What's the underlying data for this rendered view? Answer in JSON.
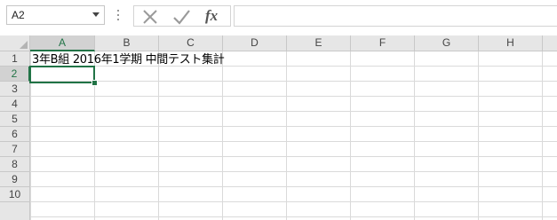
{
  "formula_bar": {
    "name_box_value": "A2",
    "fx_label": "fx",
    "formula_value": ""
  },
  "columns": [
    "A",
    "B",
    "C",
    "D",
    "E",
    "F",
    "G",
    "H"
  ],
  "rows": [
    "1",
    "2",
    "3",
    "4",
    "5",
    "6",
    "7",
    "8",
    "9",
    "10"
  ],
  "selected_cell": {
    "column": "A",
    "row": "2"
  },
  "cells": {
    "A1": "3年B組 2016年1学期 中間テスト集計"
  },
  "colors": {
    "selection": "#217346",
    "header_bg": "#e6e6e6",
    "gridline": "#dadada"
  }
}
